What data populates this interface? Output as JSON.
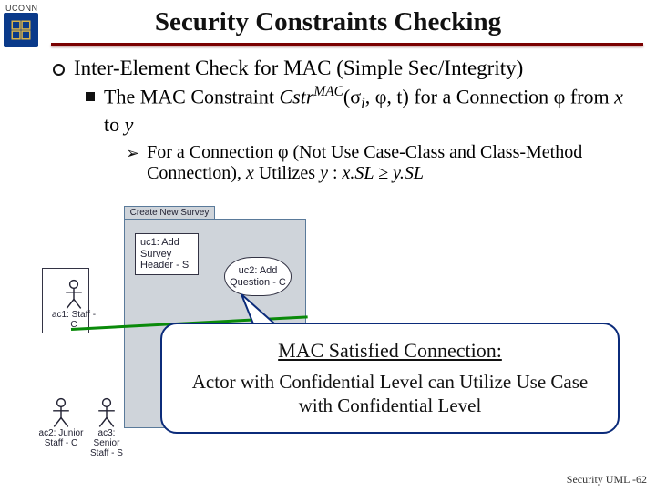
{
  "title": "Security Constraints Checking",
  "logo_text": "UCONN",
  "bullet_main": "Inter-Element Check for MAC (Simple Sec/Integrity)",
  "bullet_sub1_a": "The MAC Constraint ",
  "bullet_sub1_b": "Cstr",
  "bullet_sub1_sup": "MAC",
  "bullet_sub1_c": "(σ",
  "bullet_sub1_subi": "i",
  "bullet_sub1_d": ", φ, t) for a Connection φ from ",
  "bullet_sub1_e": "x",
  "bullet_sub1_f": " to ",
  "bullet_sub1_g": "y",
  "bullet_sub2_a": "For a Connection φ (Not Use Case-Class and Class-Method Connection), ",
  "bullet_sub2_b": "x",
  "bullet_sub2_c": " Utilizes ",
  "bullet_sub2_d": "y",
  "bullet_sub2_e": " : ",
  "bullet_sub2_f": "x.SL ≥ y.SL",
  "diagram": {
    "package_label": "Create New Survey",
    "uc1": "uc1: Add Survey Header - S",
    "uc2": "uc2: Add Question - C",
    "ac1": "ac1: Staff - C",
    "ac2": "ac2: Junior Staff - C",
    "ac3": "ac3: Senior Staff - S"
  },
  "callout": {
    "title": "MAC Satisfied Connection:",
    "body": "Actor with Confidential Level can Utilize Use Case with Confidential Level"
  },
  "footer": "Security UML -62"
}
